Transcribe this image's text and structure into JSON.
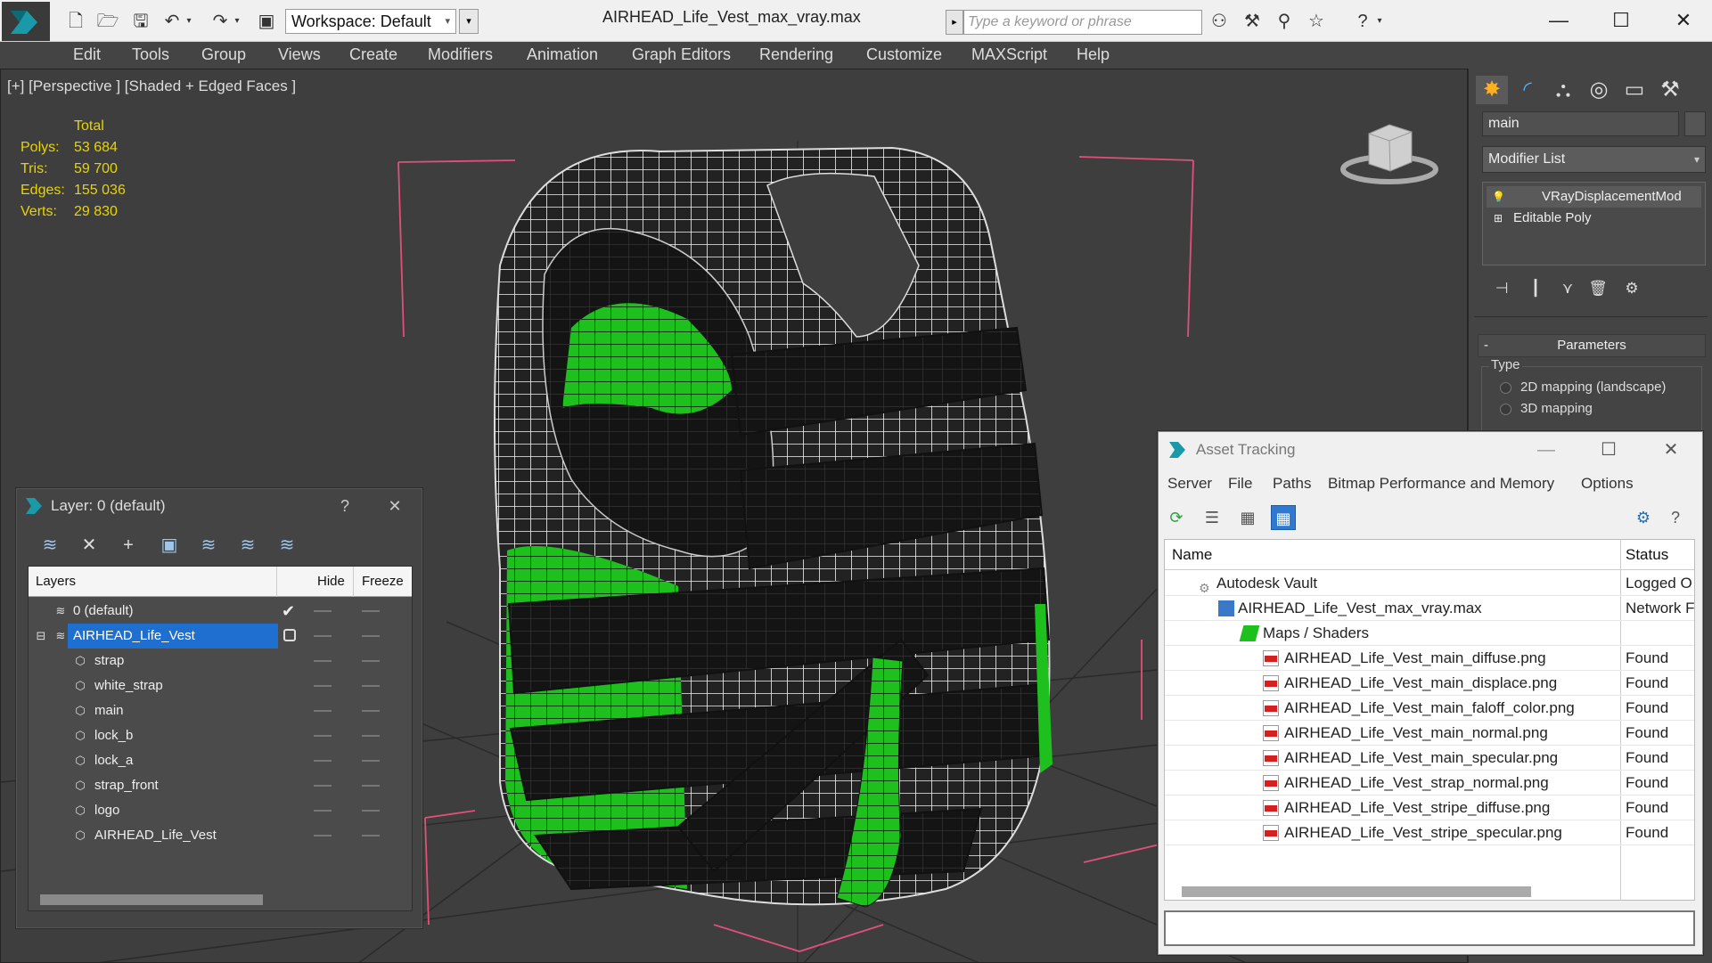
{
  "app": {
    "title": "AIRHEAD_Life_Vest_max_vray.max",
    "workspace": "Workspace: Default",
    "search_placeholder": "Type a keyword or phrase"
  },
  "menu": [
    "Edit",
    "Tools",
    "Group",
    "Views",
    "Create",
    "Modifiers",
    "Animation",
    "Graph Editors",
    "Rendering",
    "Customize",
    "MAXScript",
    "Help"
  ],
  "viewport": {
    "label": "[+] [Perspective ] [Shaded + Edged Faces ]",
    "stats": {
      "header": "Total",
      "rows": [
        {
          "label": "Polys:",
          "value": "53 684"
        },
        {
          "label": "Tris:",
          "value": "59 700"
        },
        {
          "label": "Edges:",
          "value": "155 036"
        },
        {
          "label": "Verts:",
          "value": "29 830"
        }
      ]
    }
  },
  "command_panel": {
    "object_name": "main",
    "modifier_list": "Modifier List",
    "stack": [
      "VRayDisplacementMod",
      "Editable Poly"
    ],
    "rollout_title": "Parameters",
    "type_group": "Type",
    "options": [
      "2D mapping (landscape)",
      "3D mapping"
    ]
  },
  "layer_dialog": {
    "title": "Layer: 0 (default)",
    "help": "?",
    "columns": {
      "layers": "Layers",
      "hide": "Hide",
      "freeze": "Freeze"
    },
    "rows": [
      {
        "name": "0 (default)",
        "kind": "layer"
      },
      {
        "name": "AIRHEAD_Life_Vest",
        "kind": "layer"
      },
      {
        "name": "strap",
        "kind": "object"
      },
      {
        "name": "white_strap",
        "kind": "object"
      },
      {
        "name": "main",
        "kind": "object"
      },
      {
        "name": "lock_b",
        "kind": "object"
      },
      {
        "name": "lock_a",
        "kind": "object"
      },
      {
        "name": "strap_front",
        "kind": "object"
      },
      {
        "name": "logo",
        "kind": "object"
      },
      {
        "name": "AIRHEAD_Life_Vest",
        "kind": "object"
      }
    ]
  },
  "asset_tracking": {
    "title": "Asset Tracking",
    "menu": [
      "Server",
      "File",
      "Paths",
      "Bitmap Performance and Memory",
      "Options"
    ],
    "columns": {
      "name": "Name",
      "status": "Status"
    },
    "rows": [
      {
        "name": "Autodesk Vault",
        "status": "Logged O"
      },
      {
        "name": "AIRHEAD_Life_Vest_max_vray.max",
        "status": "Network F"
      },
      {
        "name": "Maps / Shaders",
        "status": ""
      },
      {
        "name": "AIRHEAD_Life_Vest_main_diffuse.png",
        "status": "Found"
      },
      {
        "name": "AIRHEAD_Life_Vest_main_displace.png",
        "status": "Found"
      },
      {
        "name": "AIRHEAD_Life_Vest_main_faloff_color.png",
        "status": "Found"
      },
      {
        "name": "AIRHEAD_Life_Vest_main_normal.png",
        "status": "Found"
      },
      {
        "name": "AIRHEAD_Life_Vest_main_specular.png",
        "status": "Found"
      },
      {
        "name": "AIRHEAD_Life_Vest_strap_normal.png",
        "status": "Found"
      },
      {
        "name": "AIRHEAD_Life_Vest_stripe_diffuse.png",
        "status": "Found"
      },
      {
        "name": "AIRHEAD_Life_Vest_stripe_specular.png",
        "status": "Found"
      }
    ]
  },
  "colors": {
    "viewport_bg": "#3e3e3e",
    "stats_yellow": "#e8d400",
    "vest_green": "#1ec01e",
    "selection_blue": "#1f6fd1",
    "gizmo_pink": "#e0507a"
  }
}
